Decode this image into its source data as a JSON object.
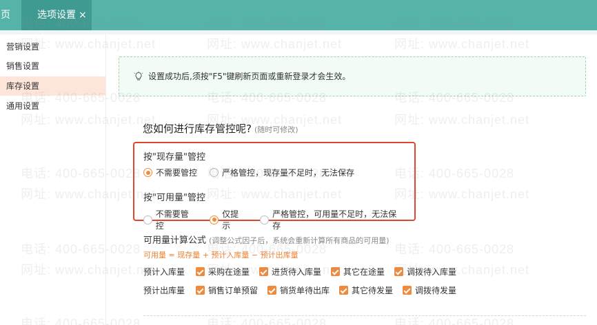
{
  "tabs": {
    "home_label": "页",
    "active_label": "选项设置",
    "close_glyph": "×"
  },
  "sidebar": {
    "items": [
      {
        "label": "营销设置"
      },
      {
        "label": "销售设置"
      },
      {
        "label": "库存设置",
        "active": true
      },
      {
        "label": "通用设置"
      }
    ]
  },
  "tip": {
    "icon": "lightbulb-icon",
    "text": "设置成功后,须按\"F5\"键刷新页面或重新登录才会生效。"
  },
  "section": {
    "title": "您如何进行库存管控呢?",
    "hint": "(随时可修改)"
  },
  "control": {
    "stock_group": {
      "label": "按\"现存量\"管控",
      "options": [
        {
          "label": "不需要管控",
          "checked": true
        },
        {
          "label": "严格管控，现存量不足时，无法保存",
          "checked": false
        }
      ]
    },
    "available_group": {
      "label": "按\"可用量\"管控",
      "options": [
        {
          "label": "不需要管控",
          "checked": false
        },
        {
          "label": "仅提示",
          "checked": true
        },
        {
          "label": "严格管控，可用量不足时，无法保存",
          "checked": false
        }
      ]
    }
  },
  "formula": {
    "title": "可用量计算公式",
    "hint": "(调整公式因子后，系统会重新计算所有商品的可用量)",
    "expression": "可用量 = 现存量 + 预计入库量 − 预计出库量",
    "inbound": {
      "label": "预计入库量",
      "items": [
        "采购在途量",
        "进货待入库量",
        "其它在途量",
        "调拨待入库量"
      ]
    },
    "outbound": {
      "label": "预计出库量",
      "items": [
        "销售订单预留",
        "销货单待出库",
        "其它待发量",
        "调拨待发量"
      ]
    }
  },
  "watermark": {
    "phone": "电话: 400-665-0028",
    "site": "网址: www.chanjet.net"
  },
  "colors": {
    "topbar": "#55b3a8",
    "active_tab": "#3f9b91",
    "accent": "#f08a3c",
    "highlight_border": "#e0452e",
    "sidebar_active": "#fde6d9"
  }
}
